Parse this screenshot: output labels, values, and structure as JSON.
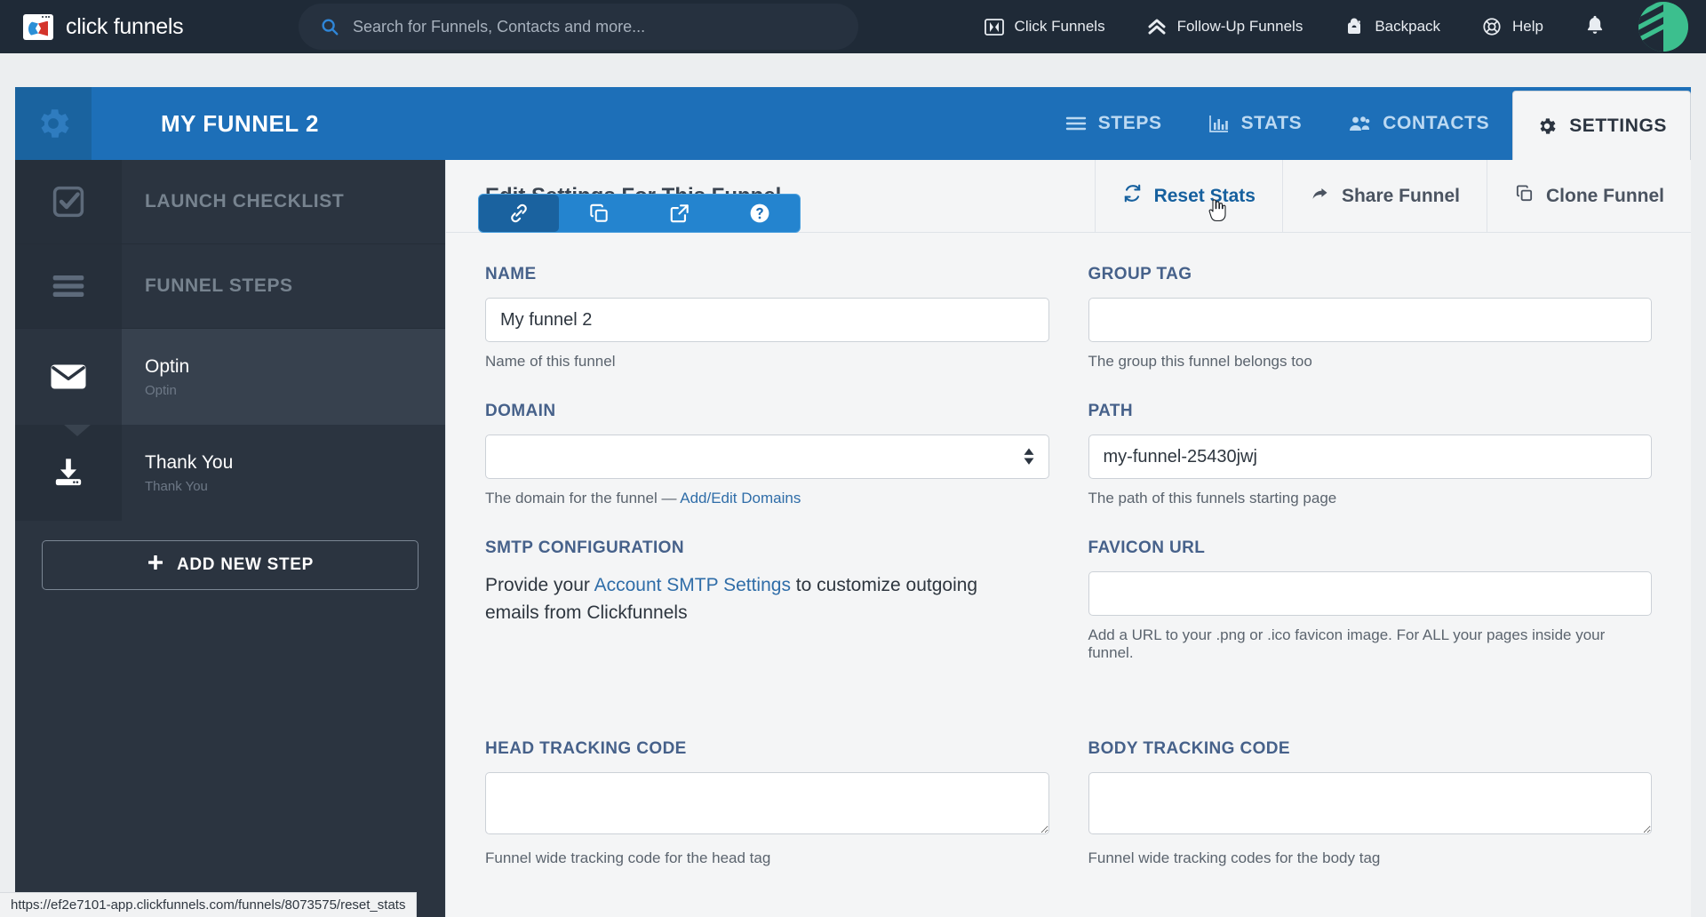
{
  "topnav": {
    "brand": "click funnels",
    "search": {
      "placeholder": "Search for Funnels, Contacts and more...",
      "value": "",
      "icon": "search-icon"
    },
    "items": [
      {
        "label": "Click Funnels",
        "icon": "clickfunnels-icon"
      },
      {
        "label": "Follow-Up Funnels",
        "icon": "chevrons-up-icon"
      },
      {
        "label": "Backpack",
        "icon": "backpack-icon"
      },
      {
        "label": "Help",
        "icon": "lifebuoy-icon"
      }
    ],
    "bell_icon": "bell-icon",
    "avatar": "user-avatar"
  },
  "funnel_header": {
    "gear_icon": "gear-icon",
    "title": "MY FUNNEL 2",
    "icon_buttons": [
      {
        "name": "link-icon",
        "active": true
      },
      {
        "name": "copy-icon",
        "active": false
      },
      {
        "name": "external-link-icon",
        "active": false
      },
      {
        "name": "question-circle-icon",
        "active": false
      }
    ],
    "tabs": [
      {
        "label": "STEPS",
        "icon": "hamburger-icon",
        "selected": false
      },
      {
        "label": "STATS",
        "icon": "bar-chart-icon",
        "selected": false
      },
      {
        "label": "CONTACTS",
        "icon": "users-icon",
        "selected": false
      },
      {
        "label": "SETTINGS",
        "icon": "gear-icon",
        "selected": true
      }
    ]
  },
  "sidebar": {
    "launch_checklist": {
      "label": "LAUNCH CHECKLIST",
      "icon": "checkbox-icon"
    },
    "funnel_steps": {
      "label": "FUNNEL STEPS",
      "icon": "list-icon"
    },
    "steps": [
      {
        "title": "Optin",
        "subtitle": "Optin",
        "icon": "envelope-icon",
        "active": true
      },
      {
        "title": "Thank You",
        "subtitle": "Thank You",
        "icon": "download-icon",
        "active": false
      }
    ],
    "add_step": {
      "label": "ADD NEW STEP",
      "icon": "plus-icon"
    }
  },
  "main": {
    "title": "Edit Settings For This Funnel",
    "actions": [
      {
        "label": "Reset Stats",
        "icon": "refresh-icon",
        "highlighted": true
      },
      {
        "label": "Share Funnel",
        "icon": "share-arrow-icon",
        "highlighted": false
      },
      {
        "label": "Clone Funnel",
        "icon": "copy-icon",
        "highlighted": false
      }
    ],
    "fields": {
      "name": {
        "label": "NAME",
        "value": "My funnel 2",
        "placeholder": "",
        "help": "Name of this funnel"
      },
      "group_tag": {
        "label": "GROUP TAG",
        "value": "",
        "placeholder": "",
        "help": "The group this funnel belongs too"
      },
      "domain": {
        "label": "DOMAIN",
        "value": "",
        "help_prefix": "The domain for the funnel — ",
        "help_link": "Add/Edit Domains"
      },
      "path": {
        "label": "PATH",
        "value": "my-funnel-25430jwj",
        "placeholder": "",
        "help": "The path of this funnels starting page"
      },
      "smtp": {
        "label": "SMTP CONFIGURATION",
        "text_before": "Provide your ",
        "link": "Account SMTP Settings",
        "text_after": " to customize outgoing emails from Clickfunnels"
      },
      "favicon": {
        "label": "FAVICON URL",
        "value": "",
        "placeholder": "",
        "help": "Add a URL to your .png or .ico favicon image. For ALL your pages inside your funnel."
      },
      "head_tracking": {
        "label": "HEAD TRACKING CODE",
        "value": "",
        "placeholder": "",
        "help": "Funnel wide tracking code for the head tag"
      },
      "body_tracking": {
        "label": "BODY TRACKING CODE",
        "value": "",
        "placeholder": "",
        "help": "Funnel wide tracking codes for the body tag"
      }
    }
  },
  "statusbar": {
    "url": "https://ef2e7101-app.clickfunnels.com/funnels/8073575/reset_stats"
  }
}
